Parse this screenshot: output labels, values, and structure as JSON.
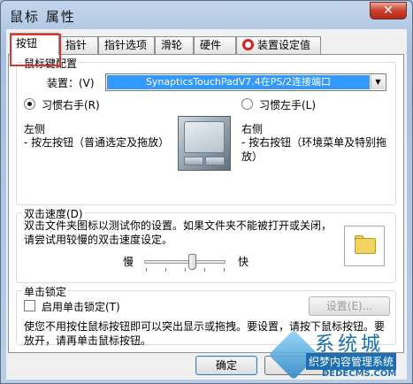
{
  "window": {
    "title": "鼠标 属性",
    "close_label": "✕"
  },
  "tabs": [
    {
      "label": "按钮"
    },
    {
      "label": "指针"
    },
    {
      "label": "指针选项"
    },
    {
      "label": "滑轮"
    },
    {
      "label": "硬件"
    },
    {
      "label": "装置设定值"
    }
  ],
  "mouse_config": {
    "group_label": "鼠标键配置",
    "device_label": "装置：(V)",
    "device_value": "SynapticsTouchPadV7.4在PS/2连接端口",
    "right_hand_label": "习惯右手(R)",
    "left_hand_label": "习惯左手(L)",
    "left_side_title": "左侧",
    "left_side_desc": "- 按左按钮（普通选定及拖放）",
    "right_side_title": "右侧",
    "right_side_desc": "- 按右按钮（环境菜单及特别拖放）"
  },
  "double_click": {
    "group_label": "双击速度(D)",
    "desc": "双击文件夹图标以测试你的设置。如果文件夹不能被打开或关闭，请尝试用较慢的双击速度设定。",
    "slow_label": "慢",
    "fast_label": "快",
    "speed": 0.6
  },
  "click_lock": {
    "group_label": "单击锁定",
    "enable_label": "启用单击锁定(T)",
    "settings_button": "设置(E)...",
    "desc": "使您不用按住鼠标按钮即可以突出显示或拖拽。要设置，请按下鼠标按钮。要放开，请再单击鼠标按钮。"
  },
  "footer": {
    "ok_button": "确定"
  },
  "watermark": {
    "brand": "系统城",
    "tagline": "织梦内容管理系统",
    "url": "DEDECMS.COM"
  }
}
